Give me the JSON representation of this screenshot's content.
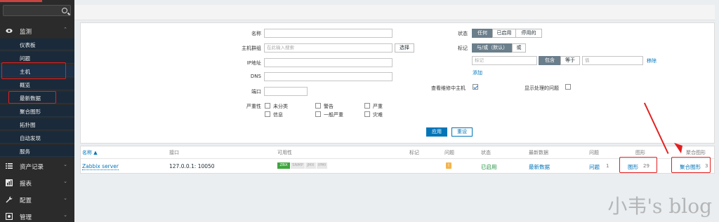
{
  "sidebar": {
    "search_placeholder": "",
    "monitoring": {
      "label": "监测",
      "icon": "eye-icon"
    },
    "monitoring_items": [
      {
        "label": "仪表板"
      },
      {
        "label": "问题"
      },
      {
        "label": "主机"
      },
      {
        "label": "概览"
      },
      {
        "label": "最新数据"
      },
      {
        "label": "聚合图形"
      },
      {
        "label": "拓扑图"
      },
      {
        "label": "自动发现"
      },
      {
        "label": "服务"
      }
    ],
    "sections": [
      {
        "label": "资产记录",
        "icon": "list-icon"
      },
      {
        "label": "报表",
        "icon": "chart-icon"
      },
      {
        "label": "配置",
        "icon": "wrench-icon"
      },
      {
        "label": "管理",
        "icon": "gear-icon"
      }
    ]
  },
  "filter": {
    "name_label": "名称",
    "hostgroup_label": "主机群组",
    "hostgroup_placeholder": "在此输入搜索",
    "select_button": "选择",
    "ip_label": "IP地址",
    "dns_label": "DNS",
    "port_label": "端口",
    "severity_label": "严重性",
    "severities": [
      "未分类",
      "警告",
      "严重",
      "信息",
      "一般严重",
      "灾难"
    ],
    "status_label": "状态",
    "status_options": [
      "任何",
      "已启用",
      "停用的"
    ],
    "tags_label": "标记",
    "tags_mode": [
      "与/或（默认）",
      "或"
    ],
    "tag_placeholder": "标记",
    "tag_ops": [
      "包含",
      "等于"
    ],
    "value_placeholder": "值",
    "remove_link": "移除",
    "add_link": "添加",
    "maintenance_label": "查看维修中主机",
    "suppressed_label": "显示处理的问题",
    "apply_button": "应用",
    "reset_button": "重设"
  },
  "table": {
    "headers": [
      "名称 ▲",
      "接口",
      "可用性",
      "标记",
      "问题",
      "状态",
      "最新数据",
      "问题",
      "图形",
      "聚合图形"
    ],
    "row": {
      "name": "Zabbix server",
      "interface": "127.0.0.1: 10050",
      "availability": [
        "ZBX",
        "SNMP",
        "JMX",
        "IPMI"
      ],
      "problem_badge": "!",
      "status": "已启用",
      "latest_data": "最新数据",
      "problems": "问题",
      "problems_count": "1",
      "graphs": "图形",
      "graphs_count": "29",
      "screens": "聚合图形",
      "screens_count": "3"
    }
  },
  "watermark": "小韦's blog",
  "colors": {
    "annotation_red": "#e31e1e",
    "link_blue": "#0275b8",
    "zbx_green": "#3fa53f",
    "warning_orange": "#f3b44c"
  }
}
